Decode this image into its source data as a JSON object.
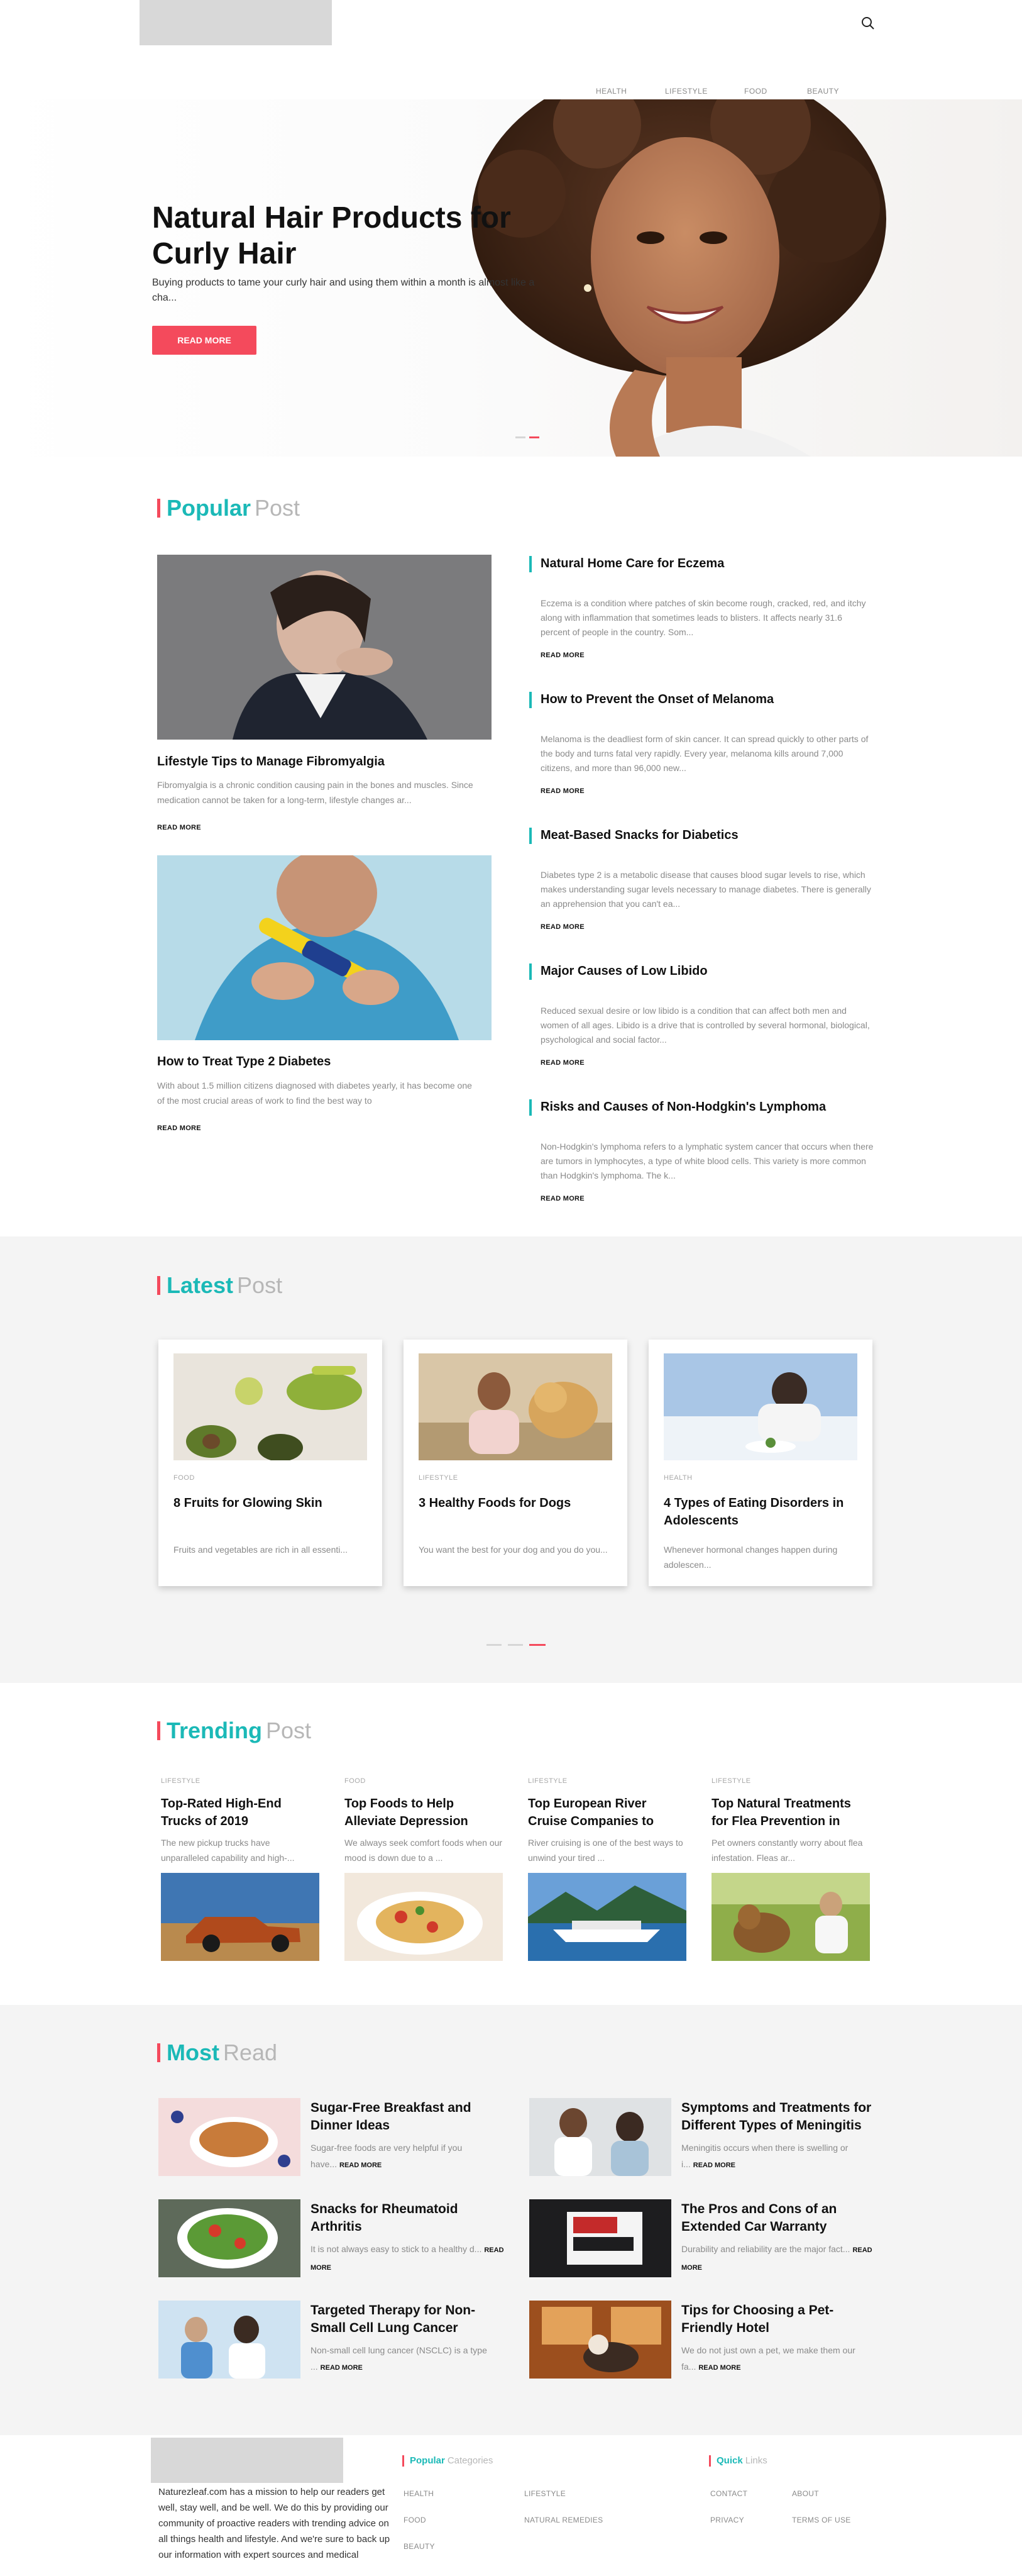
{
  "colors": {
    "accent_red": "#f44a5c",
    "accent_teal": "#1bb9b7",
    "muted_gray": "#b7b7b7",
    "band_gray": "#f4f4f4"
  },
  "header": {
    "search_icon": "search-icon"
  },
  "nav": [
    "HEALTH",
    "LIFESTYLE",
    "FOOD",
    "BEAUTY"
  ],
  "hero": {
    "title": "Natural Hair Products for Curly Hair",
    "subtitle": "Buying products to tame your curly hair and using them within a month is almost like a cha...",
    "button": "READ MORE"
  },
  "popular": {
    "title_main": "Popular",
    "title_sub": "Post",
    "featured": [
      {
        "title": "Lifestyle Tips to Manage Fibromyalgia",
        "excerpt": "Fibromyalgia is a chronic condition causing pain in the bones and muscles. Since medication cannot be taken for a long-term, lifestyle changes ar...",
        "read_more": "READ MORE"
      },
      {
        "title": "How to Treat Type 2 Diabetes",
        "excerpt": "With about 1.5 million citizens diagnosed with diabetes yearly, it has become one of the most crucial areas of work to find the best way to",
        "read_more": "READ MORE"
      }
    ],
    "list": [
      {
        "title": "Natural Home Care for Eczema",
        "excerpt": "Eczema is a condition where patches of skin become rough, cracked, red, and itchy along with inflammation that sometimes leads to blisters. It affects nearly 31.6 percent of people in the country. Som...",
        "read_more": "READ MORE"
      },
      {
        "title": "How to Prevent the Onset of Melanoma",
        "excerpt": "Melanoma is the deadliest form of skin cancer. It can spread quickly to other parts of the body and turns fatal very rapidly. Every year, melanoma kills around 7,000 citizens, and more than 96,000 new...",
        "read_more": "READ MORE"
      },
      {
        "title": "Meat-Based Snacks for Diabetics",
        "excerpt": "Diabetes type 2 is a metabolic disease that causes blood sugar levels to rise, which makes understanding sugar levels necessary to manage diabetes. There is generally an apprehension that you can't ea...",
        "read_more": "READ MORE"
      },
      {
        "title": "Major Causes of Low Libido",
        "excerpt": "Reduced sexual desire or low libido is a condition that can affect both men and women of all ages. Libido is a drive that is controlled by several hormonal, biological, psychological and social factor...",
        "read_more": "READ MORE"
      },
      {
        "title": "Risks and Causes of Non-Hodgkin's Lymphoma",
        "excerpt": "Non-Hodgkin's lymphoma refers to a lymphatic system cancer that occurs when there are tumors in lymphocytes, a type of white blood cells. This variety is more common than Hodgkin's lymphoma. The k...",
        "read_more": "READ MORE"
      }
    ]
  },
  "latest": {
    "title_main": "Latest",
    "title_sub": "Post",
    "cards": [
      {
        "category": "FOOD",
        "title": "8 Fruits for Glowing Skin",
        "excerpt": "Fruits and vegetables are rich in all essenti..."
      },
      {
        "category": "LIFESTYLE",
        "title": "3 Healthy Foods for Dogs",
        "excerpt": "You want the best for your dog and you do you..."
      },
      {
        "category": "HEALTH",
        "title": "4 Types of Eating Disorders in Adolescents",
        "excerpt": "Whenever hormonal changes happen during adolescen..."
      }
    ],
    "carousel_active_index": 2
  },
  "trending": {
    "title_main": "Trending",
    "title_sub": "Post",
    "items": [
      {
        "category": "LIFESTYLE",
        "title": "Top-Rated High-End Trucks of 2019",
        "excerpt": "The new pickup trucks have unparalleled capability and high-..."
      },
      {
        "category": "FOOD",
        "title": "Top Foods to Help Alleviate Depression",
        "excerpt": "We always seek comfort foods when our mood is down due to a ..."
      },
      {
        "category": "LIFESTYLE",
        "title": "Top European River Cruise Companies to",
        "excerpt": "River cruising is one of the best ways to unwind your tired ..."
      },
      {
        "category": "LIFESTYLE",
        "title": "Top Natural Treatments for Flea Prevention in",
        "excerpt": "Pet owners constantly worry about flea infestation. Fleas ar..."
      }
    ]
  },
  "most_read": {
    "title_main": "Most",
    "title_sub": "Read",
    "items": [
      {
        "title": "Sugar-Free Breakfast and Dinner Ideas",
        "excerpt": "Sugar-free foods are very helpful if you have...",
        "read_more": "READ MORE"
      },
      {
        "title": "Symptoms and Treatments for Different Types of Meningitis",
        "excerpt": "Meningitis occurs when there is swelling or i...",
        "read_more": "READ MORE"
      },
      {
        "title": "Snacks for Rheumatoid Arthritis",
        "excerpt": "It is not always easy to stick to a healthy d...",
        "read_more": "READ MORE"
      },
      {
        "title": "The Pros and Cons of an Extended Car Warranty",
        "excerpt": "Durability and reliability are the major fact...",
        "read_more": "READ MORE"
      },
      {
        "title": "Targeted Therapy for Non-Small Cell Lung Cancer",
        "excerpt": "Non-small cell lung cancer (NSCLC) is a type ...",
        "read_more": "READ MORE"
      },
      {
        "title": "Tips for Choosing a Pet-Friendly Hotel",
        "excerpt": "We do not just own a pet, we make them our fa...",
        "read_more": "READ MORE"
      }
    ]
  },
  "footer": {
    "about": "Naturezleaf.com has a mission to help our readers get well, stay well, and be well. We do this by providing our community of proactive readers with trending advice on all things health and lifestyle. And we're sure to back up our information with expert sources and medical",
    "categories_title_main": "Popular",
    "categories_title_sub": "Categories",
    "categories": [
      "HEALTH",
      "LIFESTYLE",
      "FOOD",
      "NATURAL REMEDIES",
      "BEAUTY"
    ],
    "links_title_main": "Quick",
    "links_title_sub": "Links",
    "links": [
      "CONTACT",
      "ABOUT",
      "PRIVACY",
      "TERMS OF USE"
    ]
  }
}
